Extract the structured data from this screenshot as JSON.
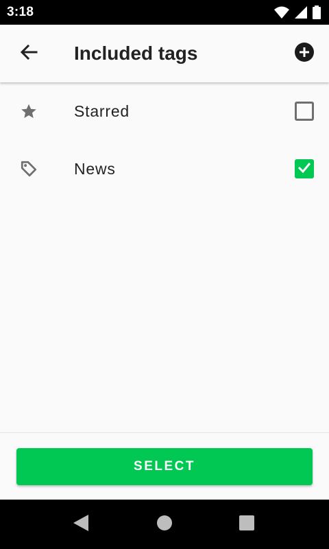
{
  "status_bar": {
    "time": "3:18"
  },
  "app_bar": {
    "title": "Included tags"
  },
  "tags": [
    {
      "label": "Starred",
      "icon": "star-icon",
      "checked": false
    },
    {
      "label": "News",
      "icon": "tag-icon",
      "checked": true
    }
  ],
  "footer": {
    "select_label": "SELECT"
  },
  "colors": {
    "accent": "#00c853",
    "background": "#fafafa",
    "text": "#222222"
  }
}
